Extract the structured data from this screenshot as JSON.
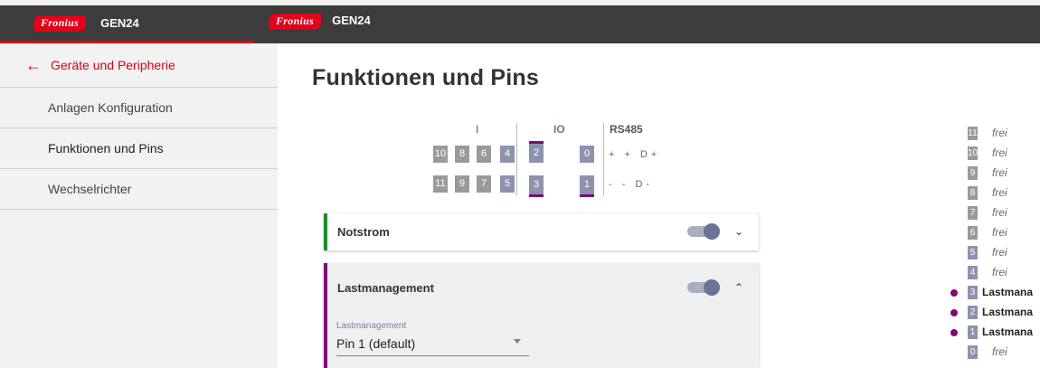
{
  "brand": {
    "logo": "Fronius",
    "product": "GEN24"
  },
  "sidebar": {
    "back_label": "Geräte und Peripherie",
    "items": [
      {
        "label": "Anlagen Konfiguration"
      },
      {
        "label": "Funktionen und Pins"
      },
      {
        "label": "Wechselrichter"
      }
    ]
  },
  "main": {
    "title": "Funktionen und Pins"
  },
  "pins": {
    "headers": {
      "i": "I",
      "io": "IO",
      "rs485": "RS485"
    },
    "top_row": [
      "10",
      "8",
      "6",
      "4",
      "2",
      "0"
    ],
    "bottom_row": [
      "11",
      "9",
      "7",
      "5",
      "3",
      "1"
    ],
    "rs_top": "+ + D+",
    "rs_bottom": "- - D-"
  },
  "cards": {
    "notstrom": {
      "title": "Notstrom",
      "enabled": true
    },
    "lastmanagement": {
      "title": "Lastmanagement",
      "enabled": true,
      "field_label": "Lastmanagement",
      "field_value": "Pin 1 (default)"
    }
  },
  "pin_list": [
    {
      "num": "11",
      "text": "frei"
    },
    {
      "num": "10",
      "text": "frei"
    },
    {
      "num": "9",
      "text": "frei"
    },
    {
      "num": "8",
      "text": "frei"
    },
    {
      "num": "7",
      "text": "frei"
    },
    {
      "num": "6",
      "text": "frei"
    },
    {
      "num": "5",
      "text": "frei"
    },
    {
      "num": "4",
      "text": "frei"
    },
    {
      "num": "3",
      "text": "Lastmana"
    },
    {
      "num": "2",
      "text": "Lastmana"
    },
    {
      "num": "1",
      "text": "Lastmana"
    },
    {
      "num": "0",
      "text": "frei"
    }
  ],
  "colors": {
    "accent": "#e2001a",
    "io_selected": "#7d0a76",
    "notstrom": "#1c8c2c"
  }
}
